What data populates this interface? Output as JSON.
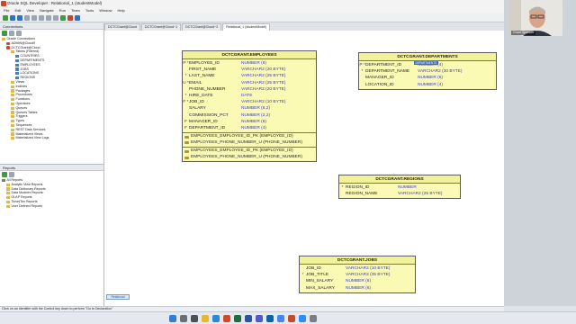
{
  "window": {
    "title": "Oracle SQL Developer : Relational_1 (studentModel)"
  },
  "menu": [
    "File",
    "Edit",
    "View",
    "Navigate",
    "Run",
    "Team",
    "Tools",
    "Window",
    "Help"
  ],
  "tabs": [
    {
      "label": "DCTCGrant@Cloud"
    },
    {
      "label": "DCTCGrant@Cloud~1"
    },
    {
      "label": "DCTCGrant@Cloud~2"
    },
    {
      "label": "Relational_1 (studentModel)"
    }
  ],
  "connections": {
    "title": "Connections",
    "tree": [
      {
        "label": "Oracle Connections",
        "icon": "folder",
        "indent": 0
      },
      {
        "label": "ADMIN@Cloud9",
        "icon": "conn",
        "indent": 1
      },
      {
        "label": "DCTCGrant@Cloud",
        "icon": "conn",
        "indent": 1
      },
      {
        "label": "Tables (Filtered)",
        "icon": "folder",
        "indent": 2
      },
      {
        "label": "COUNTRIES",
        "icon": "table",
        "indent": 3
      },
      {
        "label": "DEPARTMENTS",
        "icon": "table",
        "indent": 3
      },
      {
        "label": "EMPLOYEES",
        "icon": "table",
        "indent": 3
      },
      {
        "label": "JOBS",
        "icon": "table",
        "indent": 3
      },
      {
        "label": "LOCATIONS",
        "icon": "table",
        "indent": 3
      },
      {
        "label": "REGIONS",
        "icon": "table",
        "indent": 3
      },
      {
        "label": "Views",
        "icon": "folder",
        "indent": 2
      },
      {
        "label": "Indexes",
        "icon": "folder",
        "indent": 2
      },
      {
        "label": "Packages",
        "icon": "folder",
        "indent": 2
      },
      {
        "label": "Procedures",
        "icon": "folder",
        "indent": 2
      },
      {
        "label": "Functions",
        "icon": "folder",
        "indent": 2
      },
      {
        "label": "Operators",
        "icon": "folder",
        "indent": 2
      },
      {
        "label": "Queues",
        "icon": "folder",
        "indent": 2
      },
      {
        "label": "Queues Tables",
        "icon": "folder",
        "indent": 2
      },
      {
        "label": "Triggers",
        "icon": "folder",
        "indent": 2
      },
      {
        "label": "Types",
        "icon": "folder",
        "indent": 2
      },
      {
        "label": "Sequences",
        "icon": "folder",
        "indent": 2
      },
      {
        "label": "REST Data Services",
        "icon": "folder",
        "indent": 2
      },
      {
        "label": "Materialized Views",
        "icon": "folder",
        "indent": 2
      },
      {
        "label": "Materialized View Logs",
        "icon": "folder",
        "indent": 2
      }
    ]
  },
  "reports": {
    "title": "Reports",
    "tree": [
      {
        "label": "All Reports",
        "icon": "rep",
        "indent": 0
      },
      {
        "label": "Analytic View Reports",
        "icon": "folder",
        "indent": 1
      },
      {
        "label": "Data Dictionary Reports",
        "icon": "folder",
        "indent": 1
      },
      {
        "label": "Data Modeler Reports",
        "icon": "folder",
        "indent": 1
      },
      {
        "label": "OLAP Reports",
        "icon": "folder",
        "indent": 1
      },
      {
        "label": "TimesTen Reports",
        "icon": "folder",
        "indent": 1
      },
      {
        "label": "User Defined Reports",
        "icon": "folder",
        "indent": 1
      }
    ]
  },
  "entities": {
    "employees": {
      "title": "DCTCGRANT.EMPLOYEES",
      "columns": [
        {
          "prefix": "P *",
          "name": "EMPLOYEE_ID",
          "type": "NUMBER (6)"
        },
        {
          "prefix": "",
          "name": "FIRST_NAME",
          "type": "VARCHAR2 (20 BYTE)"
        },
        {
          "prefix": "*",
          "name": "LAST_NAME",
          "type": "VARCHAR2 (25 BYTE)"
        },
        {
          "prefix": "U *",
          "name": "EMAIL",
          "type": "VARCHAR2 (25 BYTE)"
        },
        {
          "prefix": "",
          "name": "PHONE_NUMBER",
          "type": "VARCHAR2 (20 BYTE)"
        },
        {
          "prefix": "*",
          "name": "HIRE_DATE",
          "type": "DATE"
        },
        {
          "prefix": "F *",
          "name": "JOB_ID",
          "type": "VARCHAR2 (10 BYTE)"
        },
        {
          "prefix": "",
          "name": "SALARY",
          "type": "NUMBER (8,2)"
        },
        {
          "prefix": "",
          "name": "COMMISSION_PCT",
          "type": "NUMBER (2,2)"
        },
        {
          "prefix": "F",
          "name": "MANAGER_ID",
          "type": "NUMBER (6)"
        },
        {
          "prefix": "F",
          "name": "DEPARTMENT_ID",
          "type": "NUMBER (4)"
        }
      ],
      "keys": [
        "EMPLOYEES_EMPLOYEE_ID_PK (EMPLOYEE_ID)",
        "EMPLOYEES_PHONE_NUMBER_U (PHONE_NUMBER)"
      ],
      "indexes": [
        "EMPLOYEES_EMPLOYEE_ID_PK (EMPLOYEE_ID)",
        "EMPLOYEES_PHONE_NUMBER_U (PHONE_NUMBER)"
      ]
    },
    "departments": {
      "title": "DCTCGRANT.DEPARTMENTS",
      "tooltip": "DEPARTMENTS",
      "columns": [
        {
          "prefix": "P *",
          "name": "DEPARTMENT_ID",
          "type": "NUMBER (4)"
        },
        {
          "prefix": "*",
          "name": "DEPARTMENT_NAME",
          "type": "VARCHAR2 (30 BYTE)"
        },
        {
          "prefix": "",
          "name": "MANAGER_ID",
          "type": "NUMBER (6)"
        },
        {
          "prefix": "",
          "name": "LOCATION_ID",
          "type": "NUMBER (4)"
        }
      ]
    },
    "regions": {
      "title": "DCTCGRANT.REGIONS",
      "columns": [
        {
          "prefix": "*",
          "name": "REGION_ID",
          "type": "NUMBER"
        },
        {
          "prefix": "",
          "name": "REGION_NAME",
          "type": "VARCHAR2 (25 BYTE)"
        }
      ]
    },
    "jobs": {
      "title": "DCTCGRANT.JOBS",
      "columns": [
        {
          "prefix": "",
          "name": "JOB_ID",
          "type": "VARCHAR2 (10 BYTE)"
        },
        {
          "prefix": "*",
          "name": "JOB_TITLE",
          "type": "VARCHAR2 (35 BYTE)"
        },
        {
          "prefix": "",
          "name": "MIN_SALARY",
          "type": "NUMBER (6)"
        },
        {
          "prefix": "",
          "name": "MAX_SALARY",
          "type": "NUMBER (6)"
        }
      ]
    }
  },
  "canvas_tab": "Relational",
  "webcam": {
    "name": "Grant Spencer"
  },
  "status": "Click on an identifier with the Control key down to perform \"Go to Declaration\"",
  "clock": {
    "time": "",
    "date": ""
  }
}
